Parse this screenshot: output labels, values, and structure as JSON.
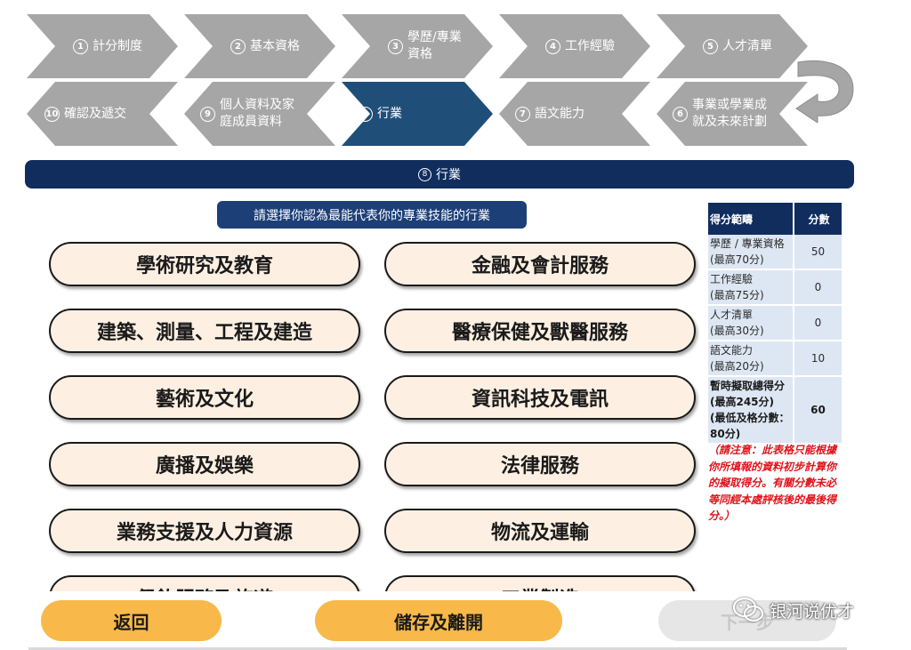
{
  "steps_forward": [
    {
      "num": "1",
      "label": "計分制度"
    },
    {
      "num": "2",
      "label": "基本資格"
    },
    {
      "num": "3",
      "label": "學歷/專業資格"
    },
    {
      "num": "4",
      "label": "工作經驗"
    },
    {
      "num": "5",
      "label": "人才清單"
    }
  ],
  "steps_back": [
    {
      "num": "10",
      "label": "確認及遞交"
    },
    {
      "num": "9",
      "label": "個人資料及家庭成員資料"
    },
    {
      "num": "8",
      "label": "行業",
      "active": true
    },
    {
      "num": "7",
      "label": "語文能力"
    },
    {
      "num": "6",
      "label": "事業或學業成就及未來計劃"
    }
  ],
  "section": {
    "num": "8",
    "title": "行業"
  },
  "prompt": "請選擇你認為最能代表你的專業技能的行業",
  "industries": [
    "學術研究及教育",
    "金融及會計服務",
    "建築、測量、工程及建造",
    "醫療保健及獸醫服務",
    "藝術及文化",
    "資訊科技及電訊",
    "廣播及娛樂",
    "法律服務",
    "業務支援及人力資源",
    "物流及運輸",
    "餐飲服務及旅遊",
    "工業製造"
  ],
  "score_table": {
    "col_range": "得分範疇",
    "col_points": "分數",
    "rows": [
      {
        "label": "學歷 / 專業資格",
        "max": "(最高70分)",
        "points": "50"
      },
      {
        "label": "工作經驗",
        "max": "(最高75分)",
        "points": "0"
      },
      {
        "label": "人才清單",
        "max": "(最高30分)",
        "points": "0"
      },
      {
        "label": "語文能力",
        "max": "(最高20分)",
        "points": "10"
      }
    ],
    "total": {
      "label": "暫時擬取總得分",
      "max": "(最高245分)",
      "min": "(最低及格分數：80分)",
      "points": "60"
    }
  },
  "note": "（請注意：此表格只能根據你所填報的資料初步計算你的擬取得分。有關分數未必等同經本處評核後的最後得分。）",
  "buttons": {
    "back": "返回",
    "save": "儲存及離開",
    "next": "下一步"
  },
  "watermark": "银河说优才",
  "colors": {
    "navy": "#102d5e",
    "chevron_gray": "#a6a6a6",
    "chevron_active": "#1f4e79",
    "option_fill": "#fdf0e3",
    "button_orange": "#f8b84a",
    "note_red": "#e0121a"
  }
}
